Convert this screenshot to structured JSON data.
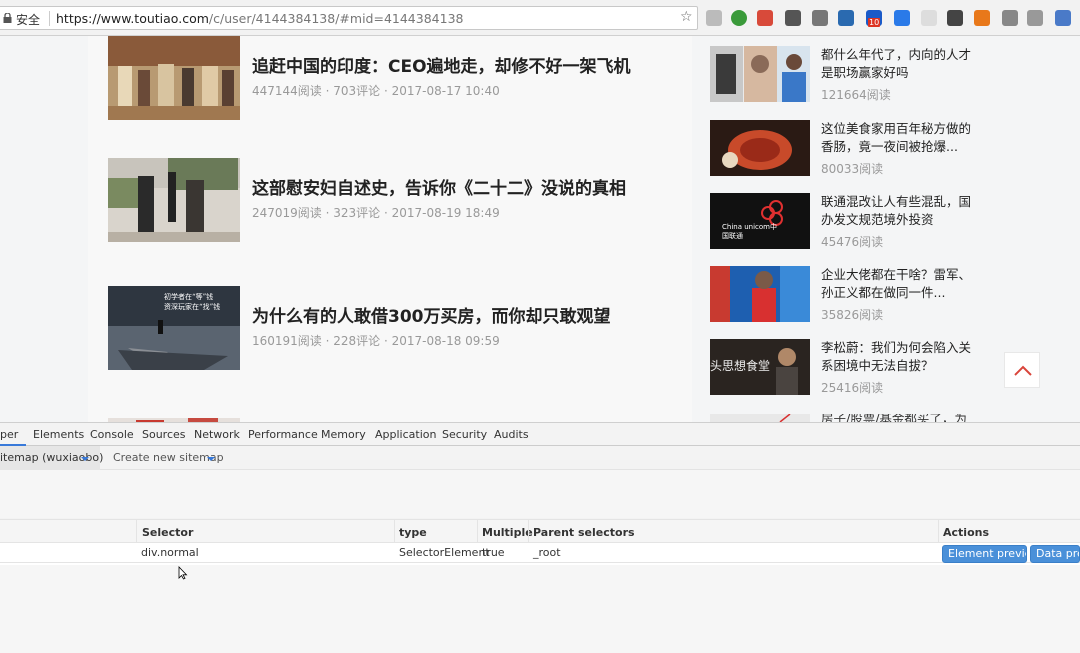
{
  "browser": {
    "secure_label": "安全",
    "url_host": "https://www.toutiao.com",
    "url_path": "/c/user/4144384138/#mid=4144384138",
    "extension_icons": [
      "shield-icon",
      "circle-icon",
      "cross-icon",
      "hand-icon",
      "box-icon",
      "s-icon",
      "badge-icon",
      "square-icon",
      "doc-icon",
      "pocket-icon",
      "flower-icon",
      "camera-icon",
      "dots-icon",
      "globe-icon"
    ],
    "badge_count": "10"
  },
  "articles": [
    {
      "title": "追赶中国的印度：CEO遍地走，却修不好一架飞机",
      "meta": "447144阅读 · 703评论 · 2017-08-17 10:40"
    },
    {
      "title": "这部慰安妇自述史，告诉你《二十二》没说的真相",
      "meta": "247019阅读 · 323评论 · 2017-08-19 18:49"
    },
    {
      "title": "为什么有的人敢借300万买房，而你却只敢观望",
      "meta": "160191阅读 · 228评论 · 2017-08-18 09:59",
      "thumb_text": "初学者在“等”钱\n资深玩家在“找”钱"
    }
  ],
  "sidebar": [
    {
      "title": "都什么年代了，内向的人才是职场赢家好吗",
      "reads": "121664阅读"
    },
    {
      "title": "这位美食家用百年秘方做的香肠，竟一夜间被抢爆...",
      "reads": "80033阅读"
    },
    {
      "title": "联通混改让人有些混乱，国办发文规范境外投资",
      "reads": "45476阅读",
      "logo_text": "China unicom中国联通"
    },
    {
      "title": "企业大佬都在干啥？雷军、孙正义都在做同一件...",
      "reads": "35826阅读"
    },
    {
      "title": "李松蔚：我们为何会陷入关系困境中无法自拔？",
      "reads": "25416阅读",
      "thumb_text": "头思想食堂"
    },
    {
      "title": "房子/股票/基金都买了，为"
    }
  ],
  "devtools": {
    "tabs": [
      "per",
      "Elements",
      "Console",
      "Sources",
      "Network",
      "Performance",
      "Memory",
      "Application",
      "Security",
      "Audits"
    ],
    "sitemap_label": "itemap (wuxiaobo)",
    "create_sitemap": "Create new sitemap",
    "table": {
      "headers": [
        "Selector",
        "type",
        "Multiple",
        "Parent selectors",
        "Actions"
      ],
      "row": {
        "selector": "div.normal",
        "type": "SelectorElement",
        "multiple": "true",
        "parent": "_root"
      },
      "buttons": [
        "Element preview",
        "Data previ"
      ]
    }
  },
  "colors": {
    "accent": "#3879d9",
    "button": "#4a90d9",
    "back_top_arrow": "#d9453b"
  }
}
